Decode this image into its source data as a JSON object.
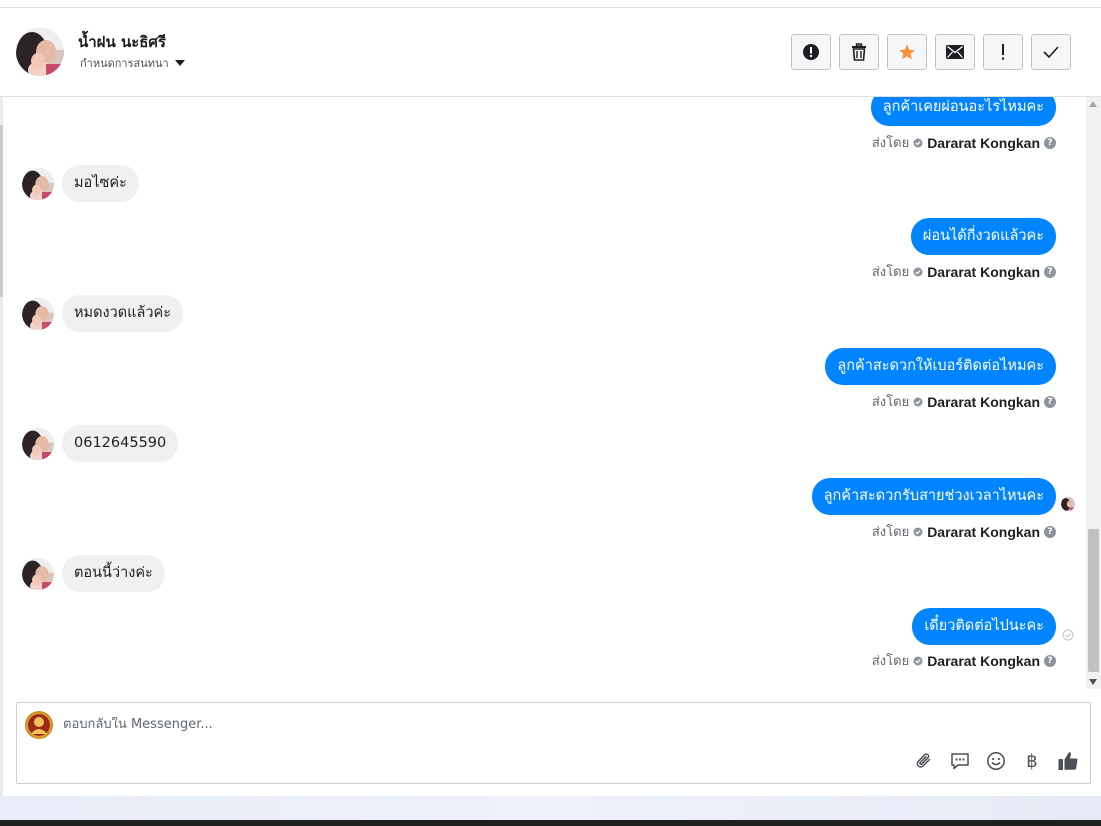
{
  "header": {
    "name": "น้ำฝน นะธิศรี",
    "subtitle": "กำหนดการสนทนา",
    "actions": [
      {
        "id": "spam",
        "icon": "alert-circle-icon"
      },
      {
        "id": "delete",
        "icon": "trash-icon"
      },
      {
        "id": "star",
        "icon": "star-icon"
      },
      {
        "id": "unread",
        "icon": "envelope-icon"
      },
      {
        "id": "important",
        "icon": "exclamation-icon"
      },
      {
        "id": "done",
        "icon": "check-icon"
      }
    ]
  },
  "thread": {
    "sent_by_label": "ส่งโดย",
    "sender": "Dararat Kongkan",
    "messages": [
      {
        "dir": "out",
        "text": "ลูกค้าเคยผ่อนอะไรไหมคะ"
      },
      {
        "dir": "in",
        "text": "มอไซค่ะ"
      },
      {
        "dir": "out",
        "text": "ผ่อนได้กี่งวดแล้วคะ"
      },
      {
        "dir": "in",
        "text": "หมดงวดแล้วค่ะ"
      },
      {
        "dir": "out",
        "text": "ลูกค้าสะดวกให้เบอร์ติดต่อไหมคะ"
      },
      {
        "dir": "in",
        "text": "0612645590"
      },
      {
        "dir": "out",
        "text": "ลูกค้าสะดวกรับสายช่วงเวลาไหนคะ"
      },
      {
        "dir": "in",
        "text": "ตอนนี้ว่างค่ะ"
      },
      {
        "dir": "out",
        "text": "เดี๋ยวติดต่อไปนะคะ"
      }
    ]
  },
  "composer": {
    "placeholder": "ตอบกลับใน Messenger...",
    "tools": [
      "paperclip-icon",
      "chat-bubble-icon",
      "smile-icon",
      "baht-icon",
      "thumbs-up-icon"
    ],
    "baht_symbol": "฿"
  },
  "colors": {
    "outgoing_bubble": "#0084ff",
    "incoming_bubble": "#f1f0f0",
    "star": "#f7923b"
  }
}
